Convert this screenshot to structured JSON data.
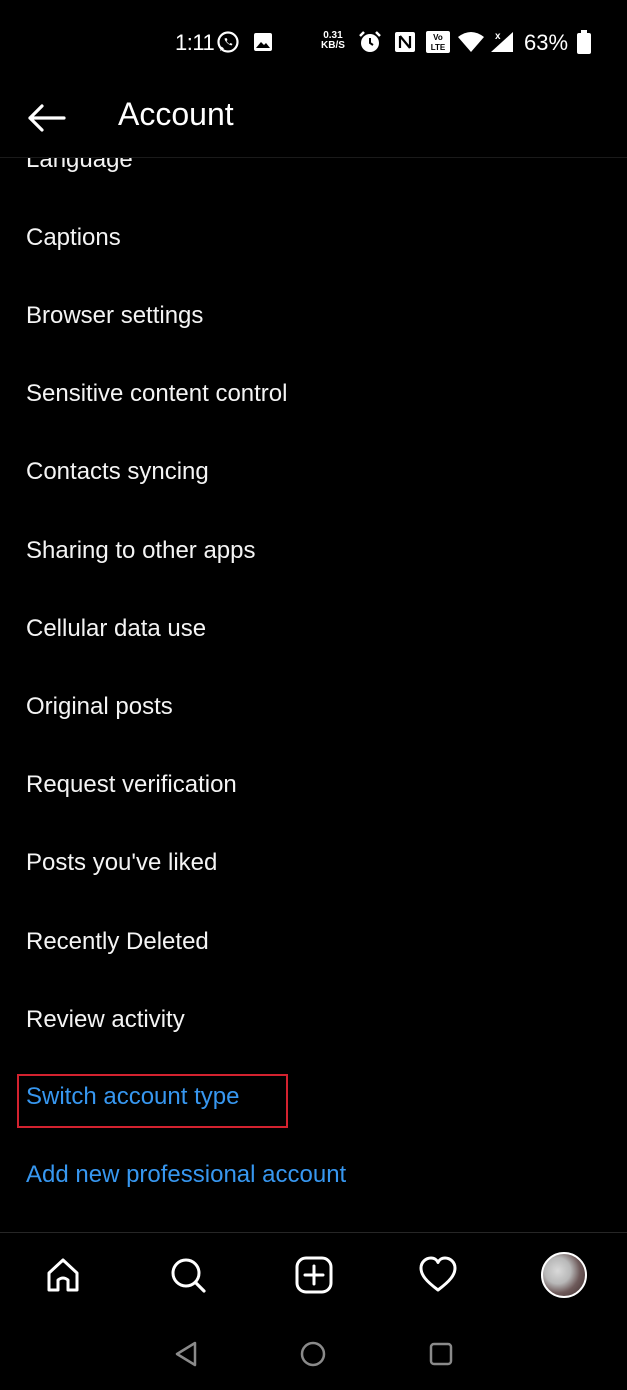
{
  "status_bar": {
    "time": "1:11",
    "net_speed_value": "0.31",
    "net_speed_unit": "KB/S",
    "battery_percent": "63%",
    "icons": [
      "whatsapp-icon",
      "gallery-icon",
      "alarm-icon",
      "nfc-icon",
      "volte-icon",
      "wifi-icon",
      "signal-icon",
      "battery-icon"
    ]
  },
  "header": {
    "title": "Account",
    "back_icon": "back-arrow-icon"
  },
  "menu": {
    "items": [
      {
        "label": "Language"
      },
      {
        "label": "Captions"
      },
      {
        "label": "Browser settings"
      },
      {
        "label": "Sensitive content control"
      },
      {
        "label": "Contacts syncing"
      },
      {
        "label": "Sharing to other apps"
      },
      {
        "label": "Cellular data use"
      },
      {
        "label": "Original posts"
      },
      {
        "label": "Request verification"
      },
      {
        "label": "Posts you've liked"
      },
      {
        "label": "Recently Deleted"
      },
      {
        "label": "Review activity"
      }
    ],
    "links": [
      {
        "label": "Switch account type"
      },
      {
        "label": "Add new professional account"
      }
    ]
  },
  "bottom_nav": {
    "items": [
      "home-icon",
      "search-icon",
      "new-post-icon",
      "activity-heart-icon",
      "profile-avatar"
    ]
  },
  "system_nav": {
    "items": [
      "back-triangle-icon",
      "home-circle-icon",
      "recents-square-icon"
    ]
  },
  "colors": {
    "background": "#000000",
    "text": "#f4f4f4",
    "link": "#3797f0",
    "highlight": "#d3222f"
  }
}
